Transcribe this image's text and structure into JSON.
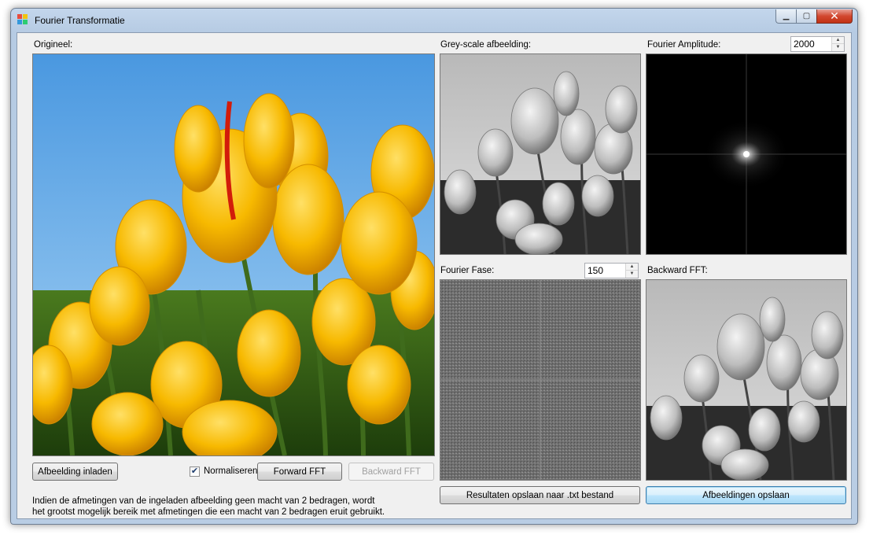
{
  "window": {
    "title": "Fourier Transformatie",
    "controls": {
      "minimize": "▁",
      "maximize": "▢",
      "close": "✕"
    }
  },
  "labels": {
    "origineel": "Origineel:",
    "greyscale": "Grey-scale afbeelding:",
    "amplitude": "Fourier Amplitude:",
    "fase": "Fourier Fase:",
    "backward": "Backward FFT:"
  },
  "spinners": {
    "amplitude_value": "2000",
    "fase_value": "150"
  },
  "buttons": {
    "load": "Afbeelding inladen",
    "forward": "Forward FFT",
    "backward": "Backward FFT",
    "save_txt": "Resultaten opslaan naar .txt bestand",
    "save_images": "Afbeeldingen opslaan"
  },
  "normalize": {
    "label": "Normaliseren",
    "checked": true,
    "mark": "✔"
  },
  "note": "Indien de afmetingen van de ingeladen afbeelding geen macht van 2 bedragen, wordt\nhet grootst mogelijk bereik met afmetingen die een macht van 2 bedragen eruit gebruikt.",
  "colors": {
    "sky": "#5ea8e8",
    "tulip": "#f5b800",
    "stem": "#3f6b1c",
    "focus_border": "#3c7fb1"
  }
}
